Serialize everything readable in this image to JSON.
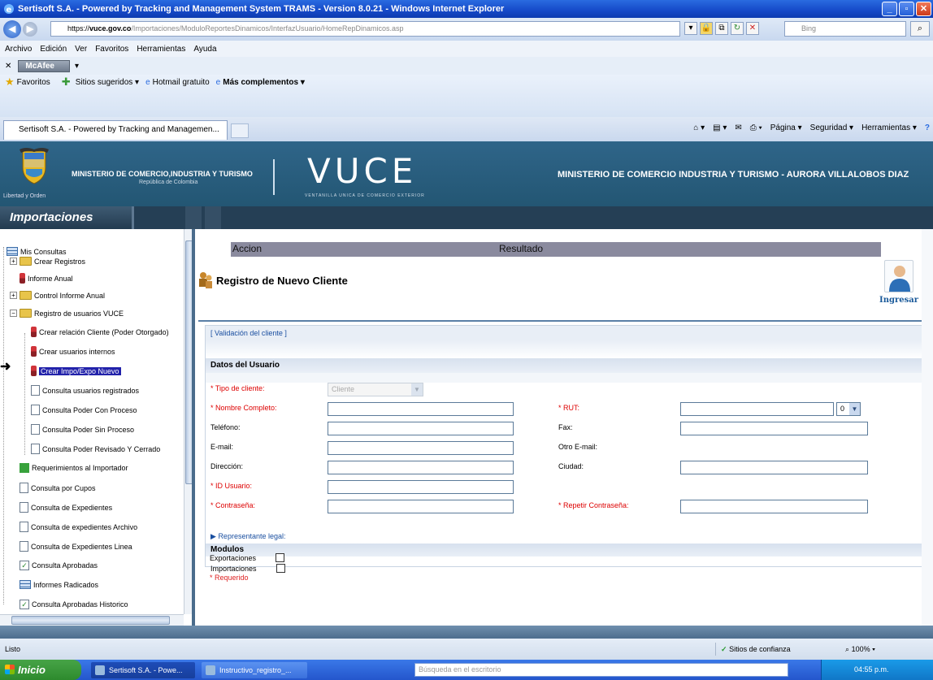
{
  "window": {
    "title": "Sertisoft S.A. - Powered by Tracking and Management System TRAMS - Version 8.0.21 - Windows Internet Explorer",
    "url_scheme": "https://",
    "url_host": "vuce.gov.co",
    "url_path": "/Importaciones/ModuloReportesDinamicos/InterfazUsuario/HomeRepDinamicos.asp",
    "search_placeholder": "Bing"
  },
  "menu": [
    "Archivo",
    "Edición",
    "Ver",
    "Favoritos",
    "Herramientas",
    "Ayuda"
  ],
  "mcafee": {
    "label": "McAfee"
  },
  "favorites": {
    "label": "Favoritos",
    "items": [
      "Sitios sugeridos ▾",
      "Hotmail gratuito",
      "Más complementos ▾"
    ]
  },
  "tab": {
    "title": "Sertisoft S.A. - Powered by Tracking and Managemen..."
  },
  "command_bar": [
    "Página ▾",
    "Seguridad ▾",
    "Herramientas ▾"
  ],
  "banner": {
    "crest_caption": "Libertad y Orden",
    "ministry": "MINISTERIO DE COMERCIO,INDUSTRIA Y TURISMO",
    "republica": "República de Colombia",
    "logo": "VUCE",
    "logo_sub": "VENTANILLA UNICA DE COMERCIO EXTERIOR",
    "user_line": "MINISTERIO DE COMERCIO INDUSTRIA Y TURISMO - AURORA VILLALOBOS DIAZ"
  },
  "module": {
    "label": "Importaciones"
  },
  "sidebar": {
    "items": [
      "Mis Consultas",
      "Crear Registros",
      "Informe Anual",
      "Control Informe Anual",
      "Registro de usuarios VUCE",
      "Crear relación Cliente (Poder Otorgado)",
      "Crear usuarios internos",
      "Crear Impo/Expo Nuevo",
      "Consulta usuarios registrados",
      "Consulta Poder Con Proceso",
      "Consulta Poder Sin Proceso",
      "Consulta Poder Revisado Y Cerrado",
      "Requerimientos al Importador",
      "Consulta por Cupos",
      "Consulta de Expedientes",
      "Consulta de expedientes Archivo",
      "Consulta de Expedientes Linea",
      "Consulta Aprobadas",
      "Informes Radicados",
      "Consulta Aprobadas Historico"
    ]
  },
  "main": {
    "col_accion": "Accion",
    "col_resultado": "Resultado",
    "title": "Registro de Nuevo Cliente",
    "ingresar": "Ingresar",
    "validacion": "[ Validación del cliente ]",
    "datos_head": "Datos del Usuario",
    "labels": {
      "tipo_cliente": "* Tipo de cliente:",
      "nombre": "* Nombre Completo:",
      "rut": "* RUT:",
      "telefono": "Teléfono:",
      "fax": "Fax:",
      "email": "E-mail:",
      "otro_email": "Otro E-mail:",
      "direccion": "Dirección:",
      "ciudad": "Ciudad:",
      "id_usuario": "* ID Usuario:",
      "contrasena": "* Contraseña:",
      "repetir": "* Repetir Contraseña:"
    },
    "tipo_cliente_value": "Cliente",
    "rut_dv_value": "0",
    "representante": "Representante legal:",
    "modulos_head": "Modulos",
    "modulo_importaciones": "Importaciones",
    "modulo_exportaciones": "Exportaciones",
    "requerido": "* Requerido"
  },
  "status": {
    "text": "Listo",
    "trust": "Sitios de confianza",
    "zoom": "100%"
  },
  "taskbar": {
    "start": "Inicio",
    "task1": "Sertisoft S.A. - Powe...",
    "task2": "Instructivo_registro_...",
    "search_placeholder": "Búsqueda en el escritorio",
    "clock": "04:55 p.m."
  }
}
